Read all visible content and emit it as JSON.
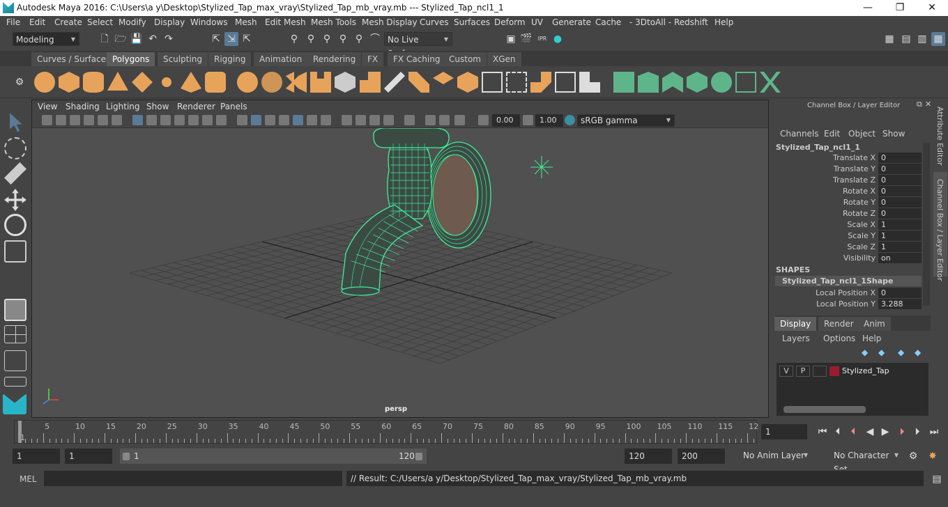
{
  "window": {
    "title": "Autodesk Maya 2016: C:\\Users\\a y\\Desktop\\Stylized_Tap_max_vray\\Stylized_Tap_mb_vray.mb   ---   Stylized_Tap_ncl1_1",
    "minimize": "—",
    "maximize": "❐",
    "close": "✕"
  },
  "menus": [
    "File",
    "Edit",
    "Create",
    "Select",
    "Modify",
    "Display",
    "Windows",
    "Mesh",
    "Edit Mesh",
    "Mesh Tools",
    "Mesh Display",
    "Curves",
    "Surfaces",
    "Deform",
    "UV",
    "Generate",
    "Cache",
    "- 3DtoAll -",
    "Redshift",
    "Help"
  ],
  "status": {
    "mode": "Modeling",
    "live_surface": "No Live Surface"
  },
  "shelf_tabs": [
    "Curves / Surfaces",
    "Polygons",
    "Sculpting",
    "Rigging",
    "Animation",
    "Rendering",
    "FX",
    "FX Caching",
    "Custom",
    "XGen"
  ],
  "shelf_active": "Polygons",
  "viewport": {
    "menus": [
      "View",
      "Shading",
      "Lighting",
      "Show",
      "Renderer",
      "Panels"
    ],
    "exposure": "0.00",
    "gamma": "1.00",
    "color_space": "sRGB gamma",
    "camera": "persp"
  },
  "channel_box": {
    "header": "Channel Box / Layer Editor",
    "menus": [
      "Channels",
      "Edit",
      "Object",
      "Show"
    ],
    "object": "Stylized_Tap_ncl1_1",
    "attributes": [
      {
        "name": "Translate X",
        "value": "0"
      },
      {
        "name": "Translate Y",
        "value": "0"
      },
      {
        "name": "Translate Z",
        "value": "0"
      },
      {
        "name": "Rotate X",
        "value": "0"
      },
      {
        "name": "Rotate Y",
        "value": "0"
      },
      {
        "name": "Rotate Z",
        "value": "0"
      },
      {
        "name": "Scale X",
        "value": "1"
      },
      {
        "name": "Scale Y",
        "value": "1"
      },
      {
        "name": "Scale Z",
        "value": "1"
      },
      {
        "name": "Visibility",
        "value": "on"
      }
    ],
    "shapes_label": "SHAPES",
    "shape_name": "Stylized_Tap_ncl1_1Shape",
    "shape_attrs": [
      {
        "name": "Local Position X",
        "value": "0"
      },
      {
        "name": "Local Position Y",
        "value": "3.288"
      }
    ]
  },
  "layer_editor": {
    "tabs": [
      "Display",
      "Render",
      "Anim"
    ],
    "active_tab": "Display",
    "menus": [
      "Layers",
      "Options",
      "Help"
    ],
    "layer": {
      "v": "V",
      "p": "P",
      "name": "Stylized_Tap",
      "color": "#9b1b30"
    }
  },
  "side_tabs": [
    "Attribute Editor",
    "Channel Box / Layer Editor"
  ],
  "timeline": {
    "ticks": [
      "1",
      "5",
      "10",
      "15",
      "20",
      "25",
      "30",
      "35",
      "40",
      "45",
      "50",
      "55",
      "60",
      "65",
      "70",
      "75",
      "80",
      "85",
      "90",
      "95",
      "100",
      "105",
      "110",
      "115",
      "12"
    ],
    "current_frame": "1"
  },
  "range": {
    "start": "1",
    "playback_start": "1",
    "slider_start": "1",
    "slider_end": "120",
    "playback_end": "120",
    "end": "200",
    "anim_layer": "No Anim Layer",
    "char_set": "No Character Set"
  },
  "command": {
    "lang": "MEL",
    "result": "// Result: C:/Users/a y/Desktop/Stylized_Tap_max_vray/Stylized_Tap_mb_vray.mb"
  }
}
